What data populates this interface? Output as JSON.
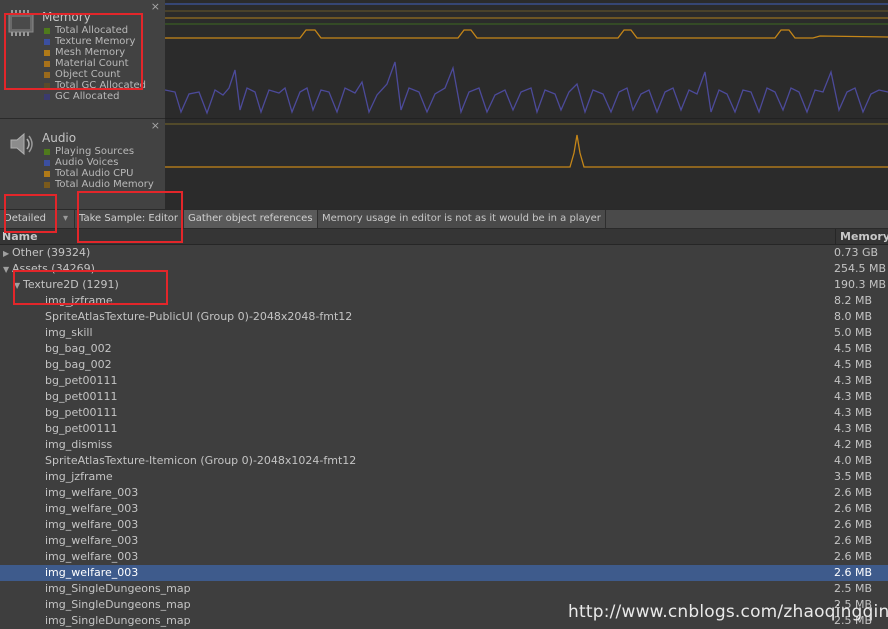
{
  "memory_module": {
    "title": "Memory",
    "close": "×",
    "icon": "memory-chip-icon",
    "legend": [
      {
        "label": "Total Allocated",
        "color": "#4f7a1c"
      },
      {
        "label": "Texture Memory",
        "color": "#3b4fa0"
      },
      {
        "label": "Mesh Memory",
        "color": "#b07a18"
      },
      {
        "label": "Material Count",
        "color": "#a8721a"
      },
      {
        "label": "Object Count",
        "color": "#9a6a1c"
      },
      {
        "label": "Total GC Allocated",
        "color": "#5a4a2a"
      },
      {
        "label": "GC Allocated",
        "color": "#3b3a6e"
      }
    ]
  },
  "audio_module": {
    "title": "Audio",
    "close": "×",
    "icon": "speaker-icon",
    "legend": [
      {
        "label": "Playing Sources",
        "color": "#4f7a1c"
      },
      {
        "label": "Audio Voices",
        "color": "#3b4fa0"
      },
      {
        "label": "Total Audio CPU",
        "color": "#b07a18"
      },
      {
        "label": "Total Audio Memory",
        "color": "#7a5a1c"
      }
    ]
  },
  "toolbar": {
    "mode": "Detailed",
    "mode_arrow": "▾",
    "take_sample": "Take Sample: Editor",
    "gather": "Gather object references",
    "note": "Memory usage in editor is not as it would be in a player"
  },
  "tree": {
    "col_name": "Name",
    "col_memory": "Memory",
    "rows": [
      {
        "name": "Other (39324)",
        "size": "0.73 GB",
        "level": 0,
        "arrow": "▶"
      },
      {
        "name": "Assets (34269)",
        "size": "254.5 MB",
        "level": 0,
        "arrow": "▼"
      },
      {
        "name": "Texture2D (1291)",
        "size": "190.3 MB",
        "level": 1,
        "arrow": "▼"
      },
      {
        "name": "img_jzframe",
        "size": "8.2 MB",
        "level": 2
      },
      {
        "name": "SpriteAtlasTexture-PublicUI (Group 0)-2048x2048-fmt12",
        "size": "8.0 MB",
        "level": 2
      },
      {
        "name": "img_skill",
        "size": "5.0 MB",
        "level": 2
      },
      {
        "name": "bg_bag_002",
        "size": "4.5 MB",
        "level": 2
      },
      {
        "name": "bg_bag_002",
        "size": "4.5 MB",
        "level": 2
      },
      {
        "name": "bg_pet00111",
        "size": "4.3 MB",
        "level": 2
      },
      {
        "name": "bg_pet00111",
        "size": "4.3 MB",
        "level": 2
      },
      {
        "name": "bg_pet00111",
        "size": "4.3 MB",
        "level": 2
      },
      {
        "name": "bg_pet00111",
        "size": "4.3 MB",
        "level": 2
      },
      {
        "name": "img_dismiss",
        "size": "4.2 MB",
        "level": 2
      },
      {
        "name": "SpriteAtlasTexture-Itemicon (Group 0)-2048x1024-fmt12",
        "size": "4.0 MB",
        "level": 2
      },
      {
        "name": "img_jzframe",
        "size": "3.5 MB",
        "level": 2
      },
      {
        "name": "img_welfare_003",
        "size": "2.6 MB",
        "level": 2
      },
      {
        "name": "img_welfare_003",
        "size": "2.6 MB",
        "level": 2
      },
      {
        "name": "img_welfare_003",
        "size": "2.6 MB",
        "level": 2
      },
      {
        "name": "img_welfare_003",
        "size": "2.6 MB",
        "level": 2
      },
      {
        "name": "img_welfare_003",
        "size": "2.6 MB",
        "level": 2
      },
      {
        "name": "img_welfare_003",
        "size": "2.6 MB",
        "level": 2,
        "selected": true
      },
      {
        "name": "img_SingleDungeons_map",
        "size": "2.5 MB",
        "level": 2
      },
      {
        "name": "img_SingleDungeons_map",
        "size": "2.5 MB",
        "level": 2
      },
      {
        "name": "img_SingleDungeons_map",
        "size": "2.5 MB",
        "level": 2
      }
    ]
  },
  "watermark": "http://www.cnblogs.com/zhaoqingqing",
  "annotation_color": "#e3262a"
}
